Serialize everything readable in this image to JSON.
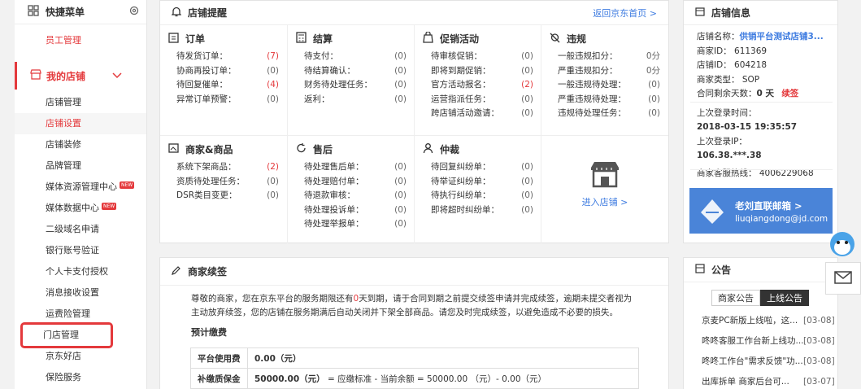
{
  "sidebar": {
    "title": "快捷菜单",
    "quick_item": "员工管理",
    "group": "我的店铺",
    "items": [
      {
        "label": "店铺管理",
        "active": false,
        "new": false
      },
      {
        "label": "店铺设置",
        "active": true,
        "new": false
      },
      {
        "label": "店铺装修",
        "active": false,
        "new": false
      },
      {
        "label": "品牌管理",
        "active": false,
        "new": false
      },
      {
        "label": "媒体资源管理中心",
        "active": false,
        "new": true
      },
      {
        "label": "媒体数据中心",
        "active": false,
        "new": true
      },
      {
        "label": "二级域名申请",
        "active": false,
        "new": false
      },
      {
        "label": "银行账号验证",
        "active": false,
        "new": false
      },
      {
        "label": "个人卡支付授权",
        "active": false,
        "new": false
      },
      {
        "label": "消息接收设置",
        "active": false,
        "new": false
      },
      {
        "label": "运费险管理",
        "active": false,
        "new": false
      },
      {
        "label": "门店管理",
        "active": false,
        "new": false,
        "highlighted": true
      },
      {
        "label": "京东好店",
        "active": false,
        "new": false
      },
      {
        "label": "保险服务",
        "active": false,
        "new": false
      }
    ],
    "new_badge": "NEW"
  },
  "reminder": {
    "title": "店铺提醒",
    "back_link": "返回京东首页 >",
    "order": {
      "title": "订单",
      "rows": [
        [
          "待发货订单：",
          "(7)"
        ],
        [
          "协商再投订单：",
          "(0)"
        ],
        [
          "待回复催单：",
          "(4)"
        ],
        [
          "异常订单预警：",
          "(0)"
        ]
      ]
    },
    "settle": {
      "title": "结算",
      "rows": [
        [
          "待支付：",
          "(0)"
        ],
        [
          "待结算确认：",
          "(0)"
        ],
        [
          "财务待处理任务：",
          "(0)"
        ],
        [
          "返利：",
          "(0)"
        ]
      ]
    },
    "promo": {
      "title": "促销活动",
      "rows": [
        [
          "待审核促销：",
          "(0)"
        ],
        [
          "即将到期促销：",
          "(0)"
        ],
        [
          "官方活动报名：",
          "(2)"
        ],
        [
          "运营指派任务：",
          "(0)"
        ],
        [
          "跨店铺活动邀请：",
          "(0)"
        ]
      ]
    },
    "violation": {
      "title": "违规",
      "rows": [
        [
          "一般违规扣分：",
          "0分"
        ],
        [
          "严重违规扣分：",
          "0分"
        ],
        [
          "一般违规待处理：",
          "(0)"
        ],
        [
          "严重违规待处理：",
          "(0)"
        ],
        [
          "违规待处理任务：",
          "(0)"
        ]
      ]
    },
    "goods": {
      "title": "商家&商品",
      "rows": [
        [
          "系统下架商品：",
          "(2)"
        ],
        [
          "资质待处理任务：",
          "(0)"
        ],
        [
          "DSR类目变更：",
          "(0)"
        ]
      ]
    },
    "aftersale": {
      "title": "售后",
      "rows": [
        [
          "待处理售后单：",
          "(0)"
        ],
        [
          "待处理赔付单：",
          "(0)"
        ],
        [
          "待退款审核：",
          "(0)"
        ],
        [
          "待处理投诉单：",
          "(0)"
        ],
        [
          "待处理举报单：",
          "(0)"
        ]
      ]
    },
    "arbitration": {
      "title": "仲裁",
      "rows": [
        [
          "待回复纠纷单：",
          "(0)"
        ],
        [
          "待举证纠纷单：",
          "(0)"
        ],
        [
          "待执行纠纷单：",
          "(0)"
        ],
        [
          "即将超时纠纷单：",
          "(0)"
        ]
      ]
    },
    "enter_store": "进入店铺 >"
  },
  "renewal": {
    "title": "商家续签",
    "notice_a": "尊敬的商家，您在京东平台的服务期限还有",
    "notice_days": "0",
    "notice_b": "天到期，请于合同到期之前提交续签申请并完成续签，逾期未提交者视为主动放弃续签，您的店铺在服务期满后自动关闭并下架全部商品。请您及时完成续签，以避免造成不必要的损失。",
    "fee_title": "预计缴费",
    "fee_rows": [
      {
        "label": "平台使用费",
        "value": "0.00（元）",
        "note": ""
      },
      {
        "label": "补缴质保金",
        "value": "50000.00（元）",
        "note": "= 应缴标准 - 当前余额 = 50000.00 （元）- 0.00（元）"
      }
    ]
  },
  "store_info": {
    "title": "店铺信息",
    "name_label": "店铺名称：",
    "name_value": "供销平台测试店铺3...",
    "merchant_id": "商家ID：  611369",
    "store_id": "店铺ID：  604218",
    "merchant_type": "商家类型：  SOP",
    "contract_label": "合同剩余天数：",
    "contract_value": "0 天",
    "renew": "续签",
    "last_login_time_label": "上次登录时间：",
    "last_login_time": "2018-03-15 19:35:57",
    "last_login_ip_label": "上次登录IP：",
    "last_login_ip": "106.38.***.38",
    "hotline": "商家客服热线：  4006229068",
    "banner_title": "老刘直联邮箱 >",
    "banner_email": "liuqiangdong@jd.com"
  },
  "announce": {
    "title": "公告",
    "tabs": [
      "商家公告",
      "上线公告"
    ],
    "items": [
      {
        "text": "京麦PC新版上线啦，这...",
        "date": "[03-08]"
      },
      {
        "text": "咚咚客服工作台新上线功...",
        "date": "[03-08]"
      },
      {
        "text": "咚咚工作台\"需求反馈\"功...",
        "date": "[03-08]"
      },
      {
        "text": "出库拆单 商家后台可...",
        "date": "[03-07]"
      }
    ]
  }
}
